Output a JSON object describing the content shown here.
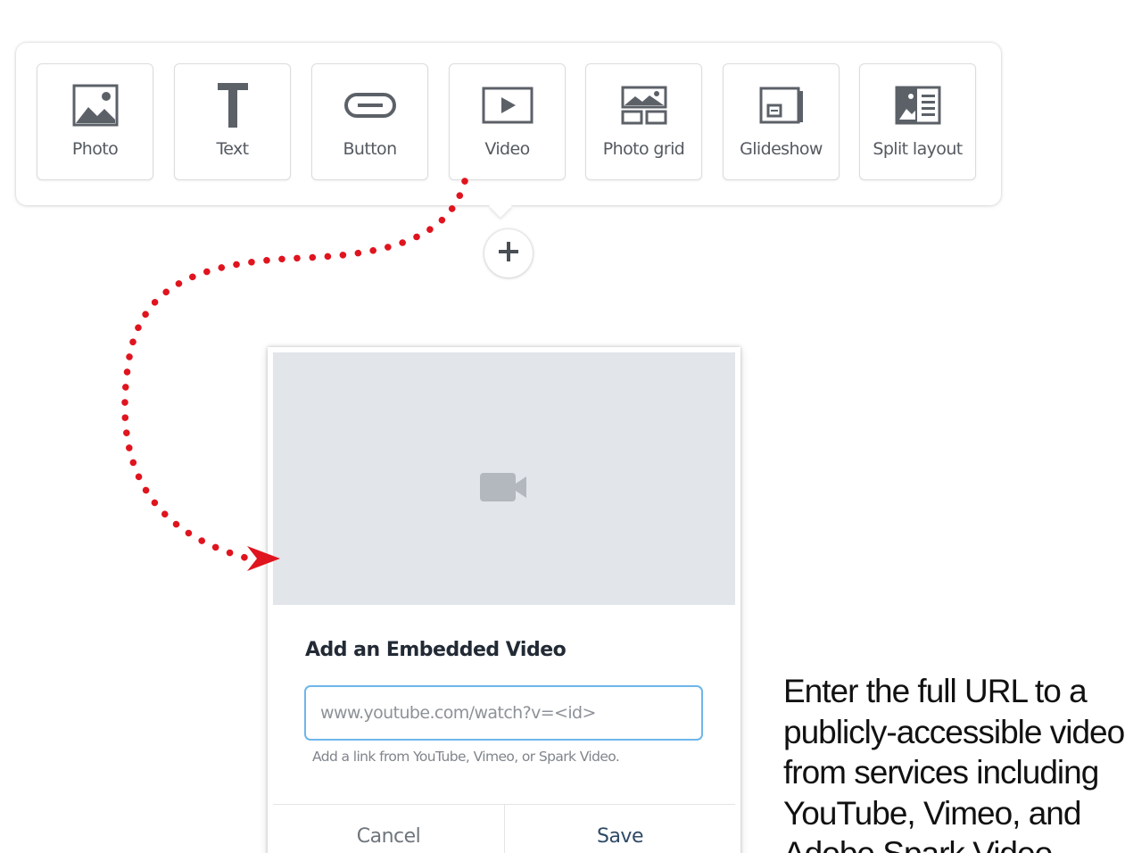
{
  "toolbar": {
    "tools": [
      {
        "label": "Photo",
        "icon": "photo-icon"
      },
      {
        "label": "Text",
        "icon": "text-icon"
      },
      {
        "label": "Button",
        "icon": "button-icon"
      },
      {
        "label": "Video",
        "icon": "video-icon"
      },
      {
        "label": "Photo grid",
        "icon": "photo-grid-icon"
      },
      {
        "label": "Glideshow",
        "icon": "glideshow-icon"
      },
      {
        "label": "Split layout",
        "icon": "split-layout-icon"
      }
    ],
    "add_icon": "plus-icon"
  },
  "dialog": {
    "preview_icon": "video-camera-icon",
    "title": "Add an Embedded Video",
    "url_placeholder": "www.youtube.com/watch?v=<id>",
    "helper": "Add a link from YouTube, Vimeo, or Spark Video.",
    "cancel_label": "Cancel",
    "save_label": "Save"
  },
  "caption": "Enter the full URL to a\npublicly-accessible video\nfrom services including\nYouTube, Vimeo, and\nAdobe Spark Video.",
  "colors": {
    "arrow": "#e0141e",
    "input_border": "#6fb6ea",
    "icon": "#5c6168",
    "preview_bg": "#e2e5e9"
  }
}
